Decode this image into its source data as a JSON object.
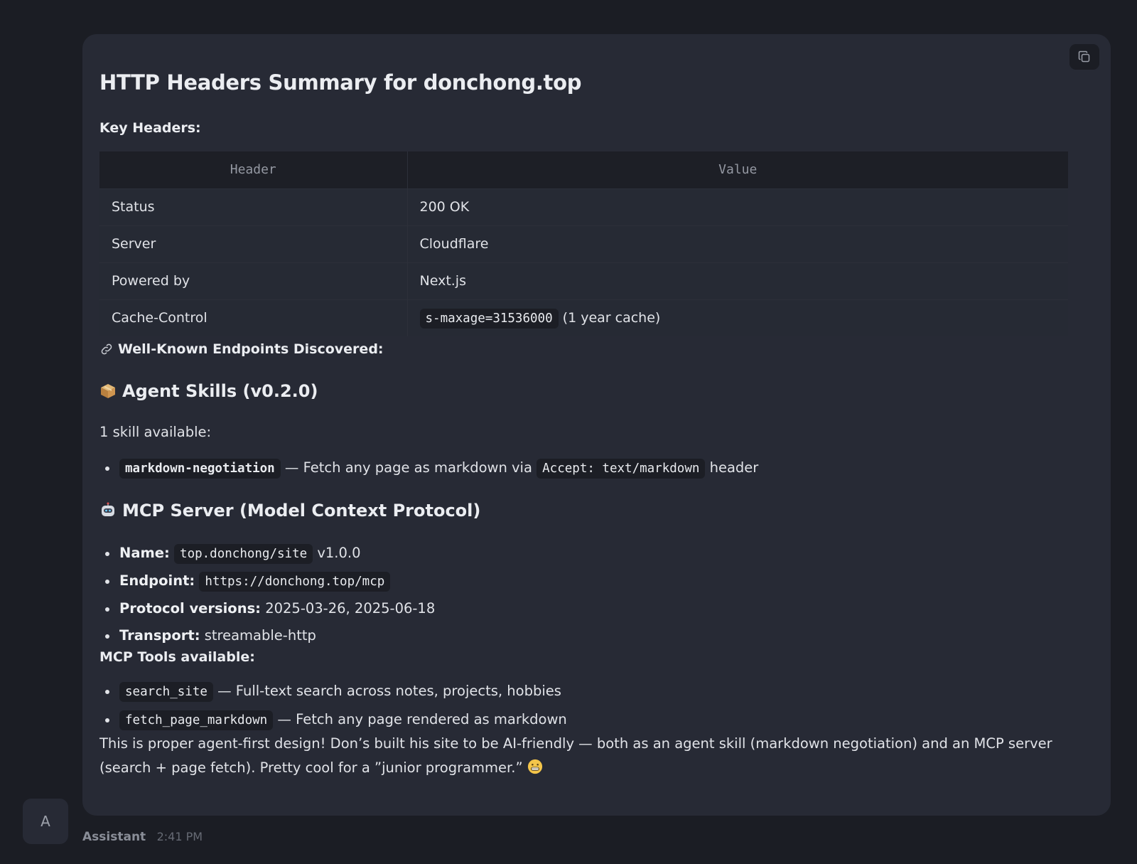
{
  "message": {
    "title": "HTTP Headers Summary for donchong.top",
    "key_headers_label": "Key Headers:",
    "table": {
      "columns": [
        "Header",
        "Value"
      ],
      "rows": [
        {
          "header": "Status",
          "value": "200 OK"
        },
        {
          "header": "Server",
          "value": "Cloudflare"
        },
        {
          "header": "Powered by",
          "value": "Next.js"
        },
        {
          "header": "Cache-Control",
          "value_code": "s-maxage=31536000",
          "value_suffix": "(1 year cache)"
        }
      ]
    },
    "endpoints_heading": "Well-Known Endpoints Discovered:",
    "skills": {
      "heading": "Agent Skills (v0.2.0)",
      "summary": "1 skill available:",
      "items": [
        {
          "code": "markdown-negotiation",
          "text_before": "— Fetch any page as markdown via",
          "inline_code": "Accept: text/markdown",
          "text_after": "header"
        }
      ]
    },
    "mcp": {
      "heading": "MCP Server (Model Context Protocol)",
      "name_label": "Name:",
      "name_code": "top.donchong/site",
      "name_version": "v1.0.0",
      "endpoint_label": "Endpoint:",
      "endpoint_code": "https://donchong.top/mcp",
      "protocol_label": "Protocol versions:",
      "protocol_value": "2025-03-26, 2025-06-18",
      "transport_label": "Transport:",
      "transport_value": "streamable-http"
    },
    "tools": {
      "heading": "MCP Tools available:",
      "items": [
        {
          "code": "search_site",
          "text": "— Full-text search across notes, projects, hobbies"
        },
        {
          "code": "fetch_page_markdown",
          "text": "— Fetch any page rendered as markdown"
        }
      ]
    },
    "closing": "This is proper agent-first design! Don’s built his site to be AI-friendly — both as an agent skill (markdown negotiation) and an MCP server (search + page fetch). Pretty cool for a ”junior programmer.”"
  },
  "avatar_letter": "A",
  "sender": "Assistant",
  "timestamp": "2:41 PM",
  "icons": {
    "copy": "copy-icon",
    "link": "link-icon",
    "package": "package-emoji",
    "robot": "robot-emoji",
    "grin": "grimacing-emoji"
  }
}
